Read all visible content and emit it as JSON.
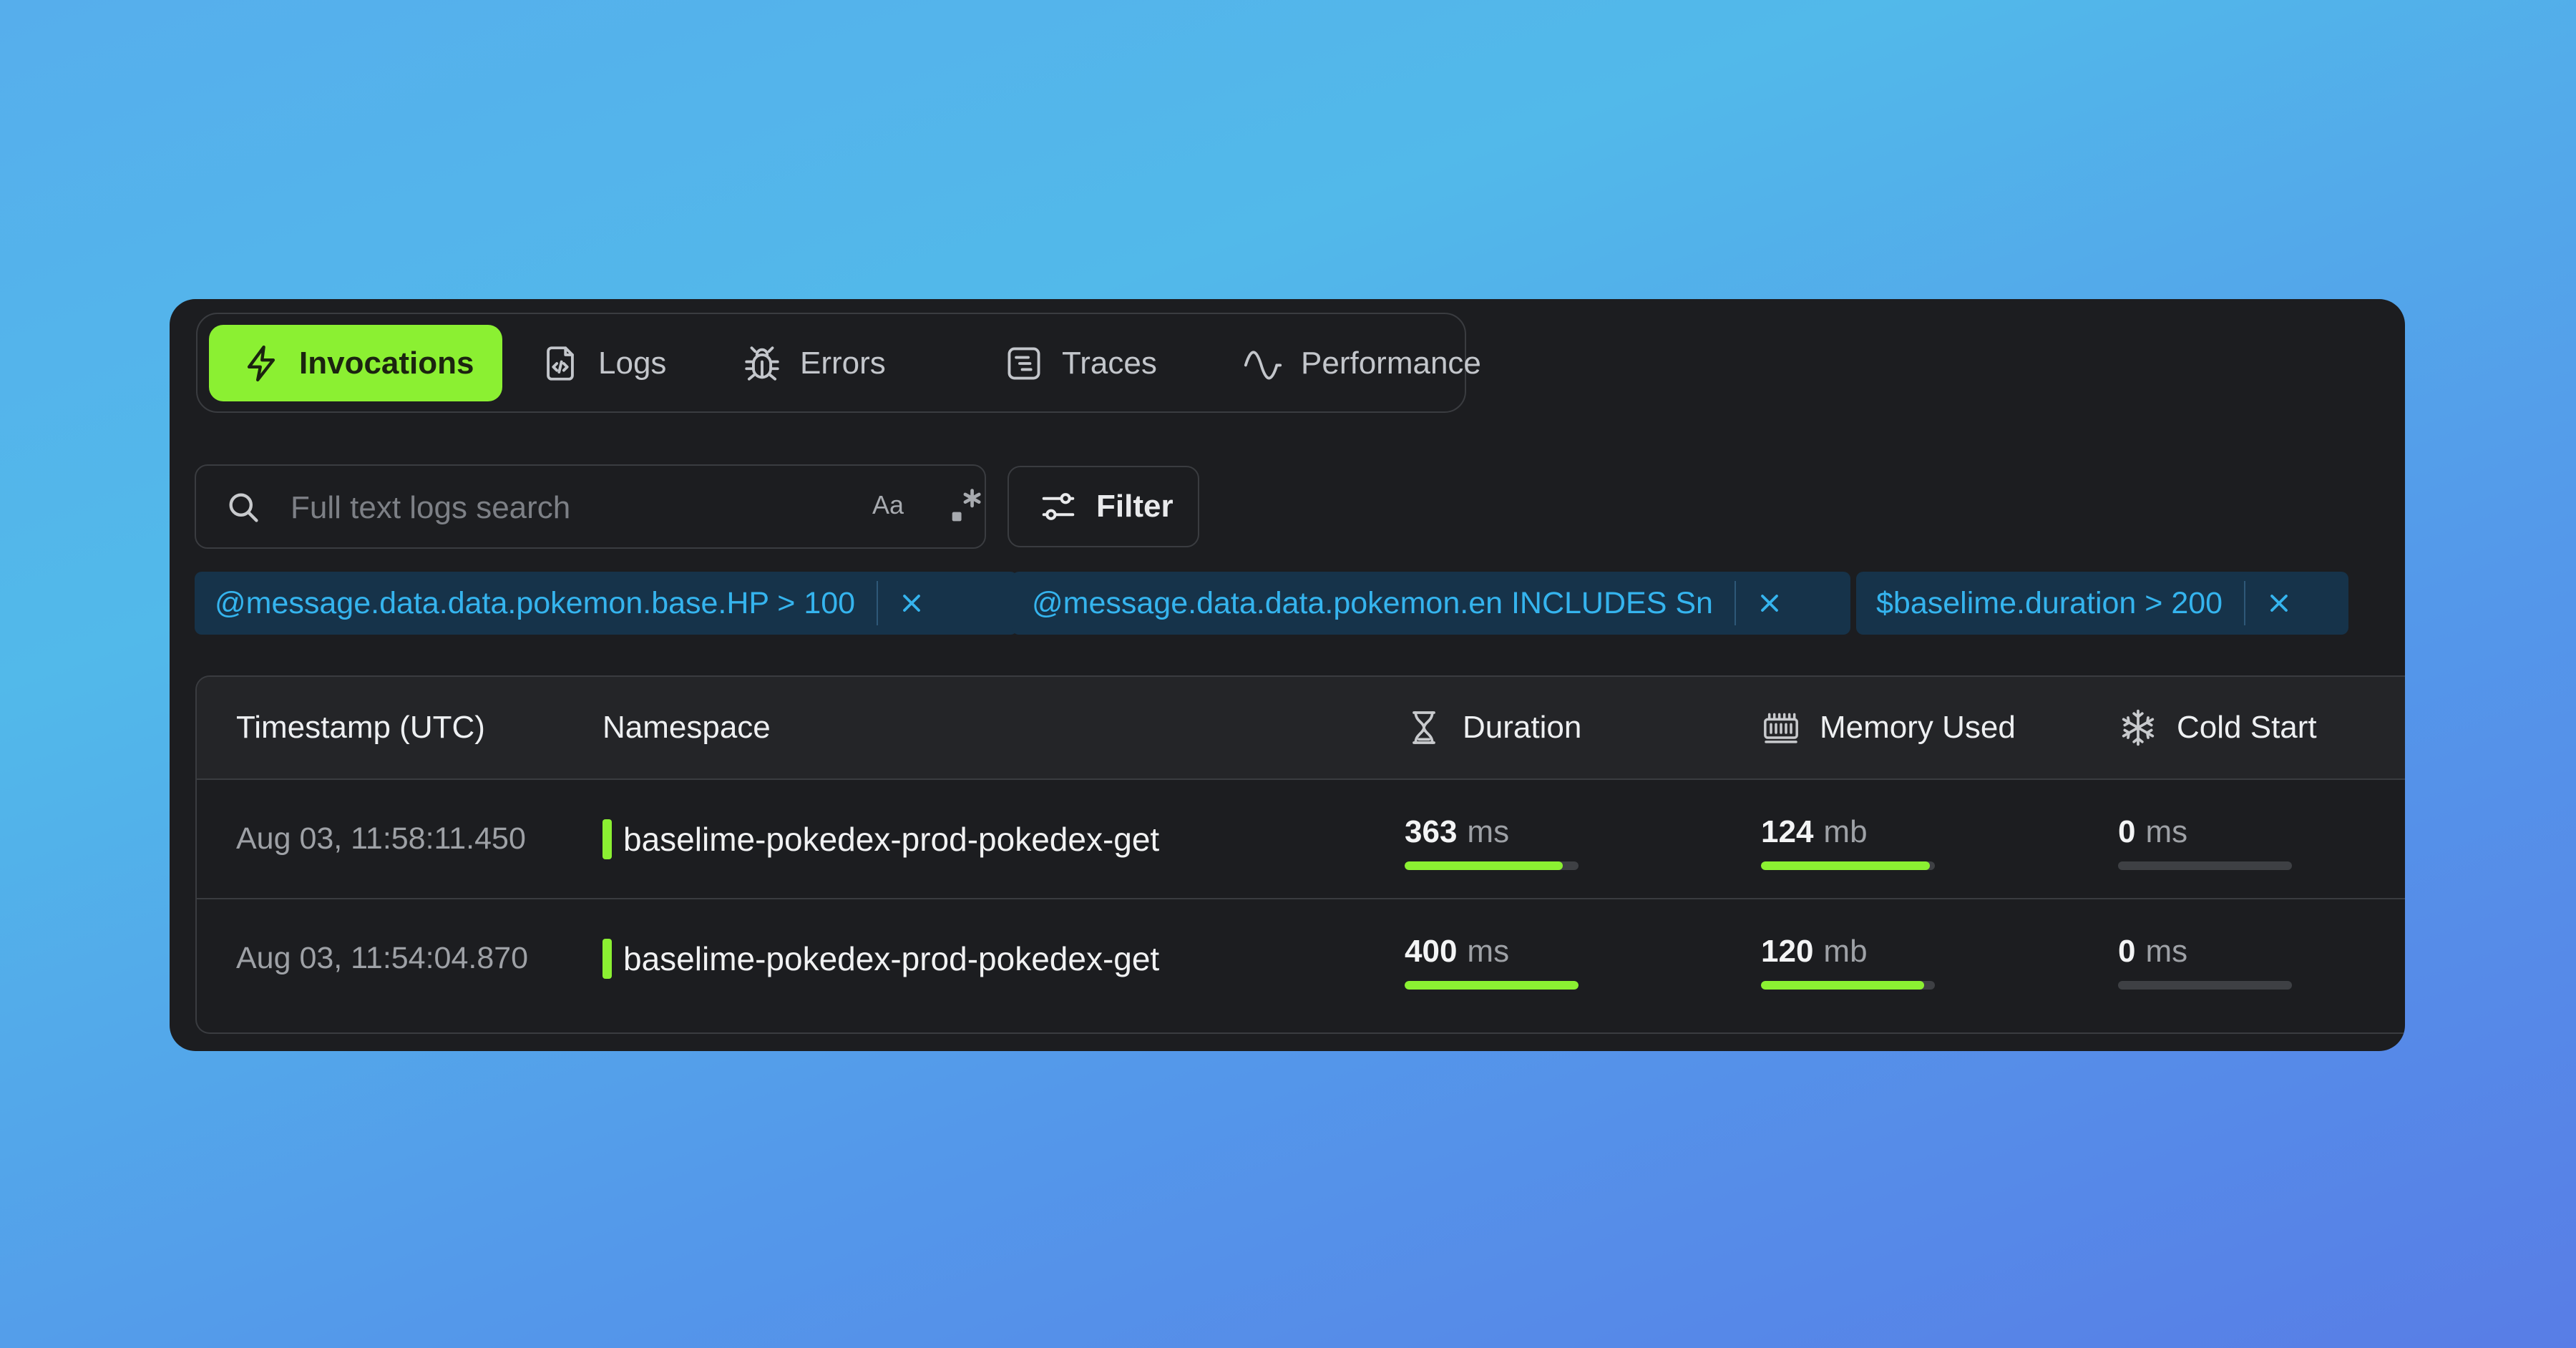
{
  "tabs": {
    "invocations": "Invocations",
    "logs": "Logs",
    "errors": "Errors",
    "traces": "Traces",
    "performance": "Performance"
  },
  "search": {
    "placeholder": "Full text logs search",
    "case_toggle": "Aa",
    "filter_label": "Filter"
  },
  "filters": [
    "@message.data.data.pokemon.base.HP > 100",
    "@message.data.data.pokemon.en INCLUDES Sn",
    "$baselime.duration > 200"
  ],
  "table": {
    "headers": {
      "timestamp": "Timestamp (UTC)",
      "namespace": "Namespace",
      "duration": "Duration",
      "memory": "Memory Used",
      "cold_start": "Cold Start"
    },
    "rows": [
      {
        "timestamp": "Aug 03, 11:58:11.450",
        "namespace": "baselime-pokedex-prod-pokedex-get",
        "duration": {
          "value": "363",
          "unit": "ms",
          "fill": 0.91
        },
        "memory": {
          "value": "124",
          "unit": "mb",
          "fill": 0.97
        },
        "cold_start": {
          "value": "0",
          "unit": "ms",
          "fill": 0
        }
      },
      {
        "timestamp": "Aug 03, 11:54:04.870",
        "namespace": "baselime-pokedex-prod-pokedex-get",
        "duration": {
          "value": "400",
          "unit": "ms",
          "fill": 1.0
        },
        "memory": {
          "value": "120",
          "unit": "mb",
          "fill": 0.94
        },
        "cold_start": {
          "value": "0",
          "unit": "ms",
          "fill": 0
        }
      }
    ]
  },
  "colors": {
    "accent": "#8bf032",
    "panel": "#1c1d20",
    "chip_bg": "#16334a",
    "chip_text": "#35b4ee"
  }
}
